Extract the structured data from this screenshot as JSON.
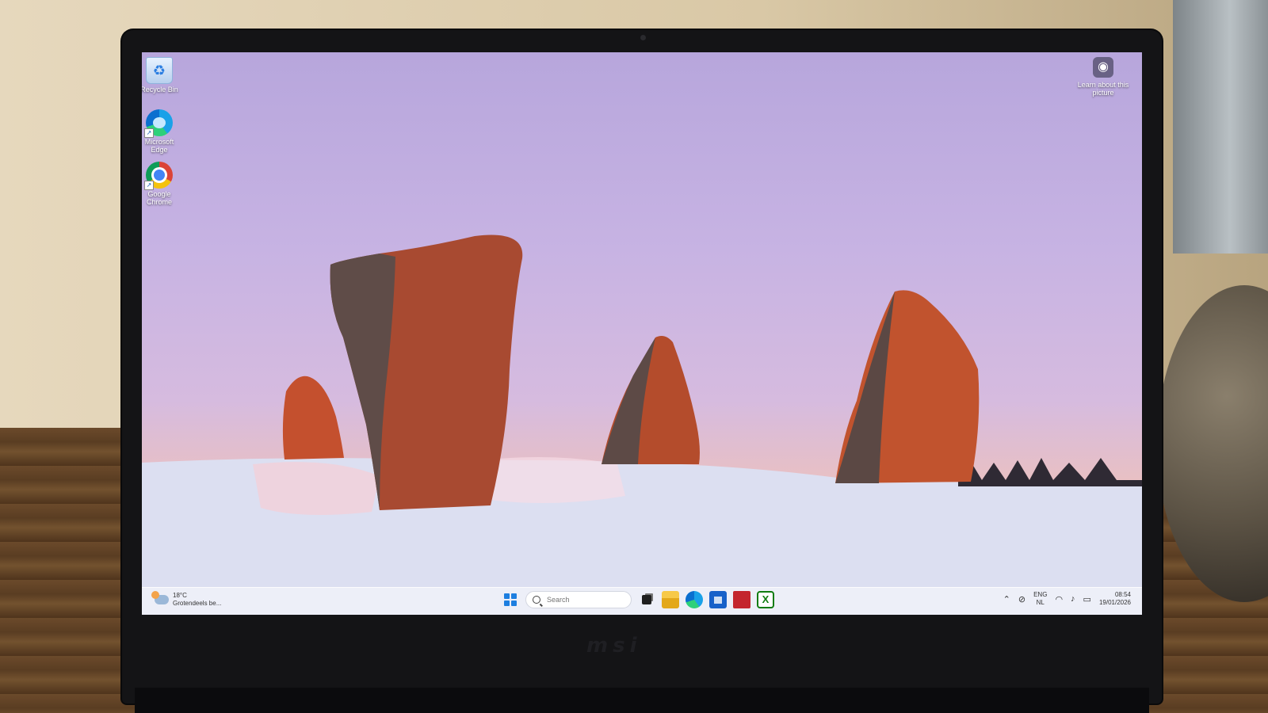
{
  "desktop": {
    "icons": [
      {
        "label": "Recycle Bin",
        "icon": "recycle-bin-icon"
      },
      {
        "label": "Microsoft Edge",
        "icon": "edge-icon"
      },
      {
        "label": "Google Chrome",
        "icon": "chrome-icon"
      }
    ],
    "learn_widget": {
      "label": "Learn about this picture",
      "icon": "camera-info-icon"
    }
  },
  "taskbar": {
    "weather": {
      "temp": "18°C",
      "desc": "Grotendeels be..."
    },
    "search_placeholder": "Search",
    "apps": [
      "start-icon",
      "widgets-icon",
      "file-explorer-icon",
      "edge-icon",
      "store-icon",
      "red-app-icon",
      "xbox-icon"
    ],
    "tray": {
      "lang_top": "ENG",
      "lang_bottom": "NL",
      "time": "08:54",
      "date": "19/01/2026"
    }
  },
  "laptop": {
    "brand": "msi"
  },
  "colors": {
    "accent": "#1e7fe0",
    "taskbar_bg": "#eef0f8"
  }
}
